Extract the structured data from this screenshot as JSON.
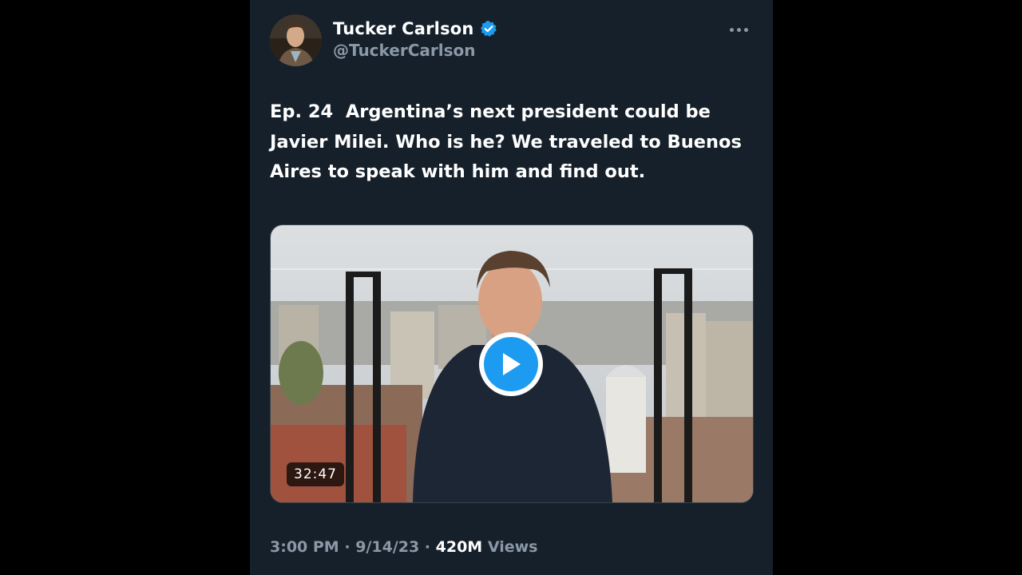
{
  "tweet": {
    "author": {
      "display_name": "Tucker Carlson",
      "handle": "@TuckerCarlson",
      "verified": true
    },
    "text": "Ep. 24  Argentina’s next president could be Javier Milei. Who is he? We traveled to Buenos Aires to speak with him and find out.",
    "media": {
      "type": "video",
      "duration": "32:47"
    },
    "time": "3:00 PM",
    "separator": "·",
    "date": "9/14/23",
    "views_count": "420M",
    "views_label": "Views"
  },
  "colors": {
    "background": "#15202b",
    "outer_background": "#000000",
    "text_primary": "#ffffff",
    "text_secondary": "#8b98a5",
    "accent": "#1d9bf0"
  },
  "icons": {
    "verified": "verified-badge-icon",
    "more": "more-options-icon",
    "play": "play-icon"
  }
}
